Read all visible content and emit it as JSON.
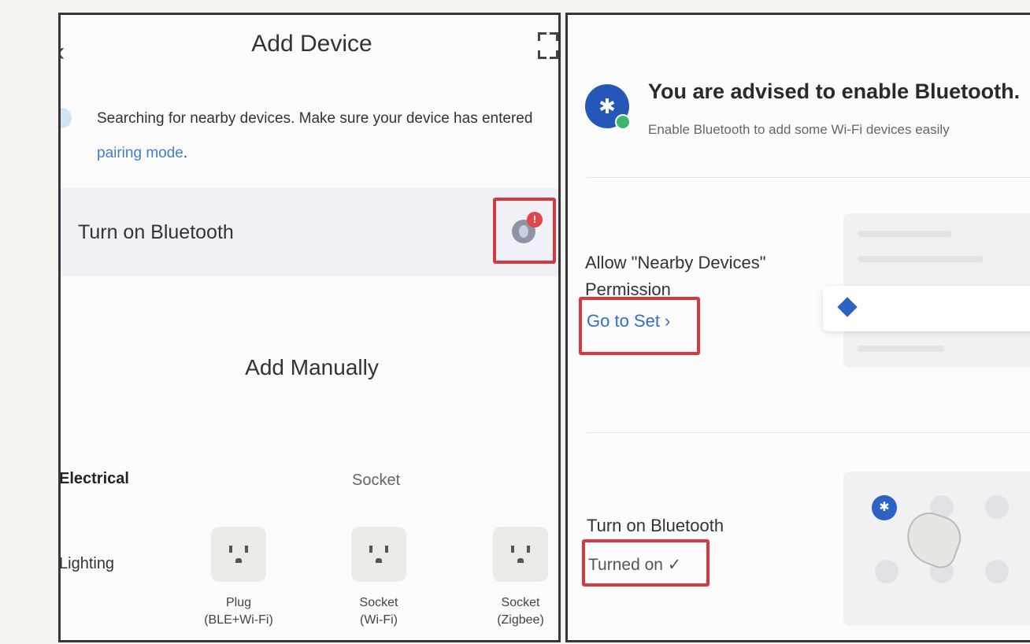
{
  "left": {
    "header": {
      "title": "Add Device"
    },
    "search_hint": {
      "text": "Searching for nearby devices. Make sure your device has entered",
      "link": "pairing mode",
      "suffix": "."
    },
    "bluetooth_row": {
      "label": "Turn on Bluetooth",
      "badge": "!"
    },
    "add_manually": {
      "title": "Add Manually"
    },
    "categories": [
      {
        "label": "Electrical",
        "active": true
      },
      {
        "label": "Lighting",
        "active": false
      }
    ],
    "subcategory": "Socket",
    "devices": [
      {
        "line1": "Plug",
        "line2": "(BLE+Wi-Fi)"
      },
      {
        "line1": "Socket",
        "line2": "(Wi-Fi)"
      },
      {
        "line1": "Socket",
        "line2": "(Zigbee)"
      }
    ]
  },
  "right": {
    "advice": {
      "title": "You are advised to enable Bluetooth.",
      "subtitle": "Enable Bluetooth to add some Wi-Fi devices easily"
    },
    "permission": {
      "label": "Allow \"Nearby Devices\" Permission",
      "action": "Go to Set ›"
    },
    "bluetooth": {
      "label": "Turn on Bluetooth",
      "status": "Turned on ✓"
    }
  },
  "colors": {
    "accent": "#2f6fc8",
    "highlight": "#d43a3e",
    "bluetooth": "#2557b8"
  }
}
